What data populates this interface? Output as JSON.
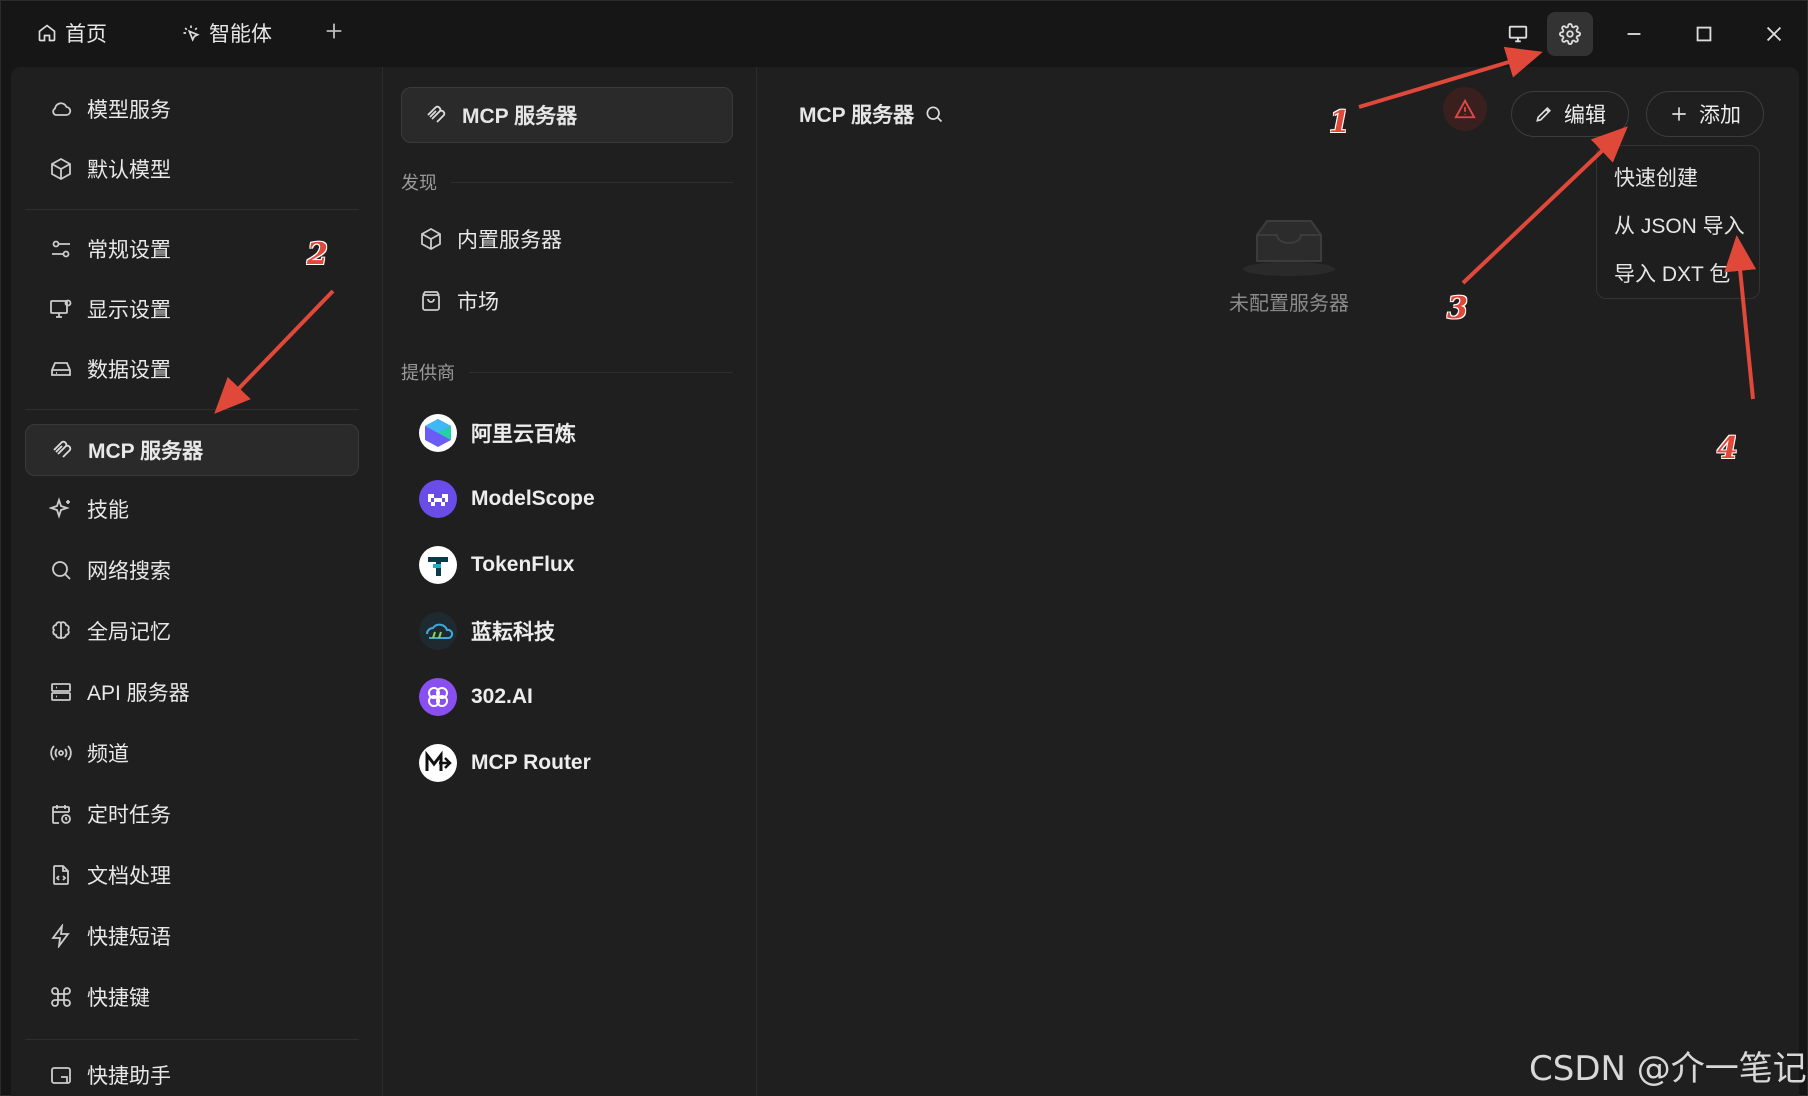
{
  "titlebar": {
    "tabs": [
      {
        "label": "首页",
        "icon": "home-icon"
      },
      {
        "label": "智能体",
        "icon": "sparkle-cursor-icon"
      }
    ]
  },
  "nav": {
    "items": [
      {
        "label": "模型服务",
        "icon": "cloud-icon"
      },
      {
        "label": "默认模型",
        "icon": "cube-icon"
      },
      {
        "label": "常规设置",
        "icon": "sliders-icon"
      },
      {
        "label": "显示设置",
        "icon": "monitor-gear-icon"
      },
      {
        "label": "数据设置",
        "icon": "hard-drive-icon"
      },
      {
        "label": "MCP 服务器",
        "icon": "mcp-icon",
        "active": true
      },
      {
        "label": "技能",
        "icon": "sparkles-icon"
      },
      {
        "label": "网络搜索",
        "icon": "search-icon"
      },
      {
        "label": "全局记忆",
        "icon": "brain-icon"
      },
      {
        "label": "API 服务器",
        "icon": "server-icon"
      },
      {
        "label": "频道",
        "icon": "broadcast-icon"
      },
      {
        "label": "定时任务",
        "icon": "calendar-clock-icon"
      },
      {
        "label": "文档处理",
        "icon": "file-code-icon"
      },
      {
        "label": "快捷短语",
        "icon": "zap-icon"
      },
      {
        "label": "快捷键",
        "icon": "command-icon"
      },
      {
        "label": "快捷助手",
        "icon": "assistant-icon"
      }
    ]
  },
  "mid": {
    "header": "MCP 服务器",
    "discover_label": "发现",
    "discover_items": [
      {
        "label": "内置服务器",
        "icon": "package-icon"
      },
      {
        "label": "市场",
        "icon": "shopping-bag-icon"
      }
    ],
    "providers_label": "提供商",
    "providers": [
      {
        "label": "阿里云百炼",
        "icon": "bailian-logo-icon"
      },
      {
        "label": "ModelScope",
        "icon": "modelscope-logo-icon"
      },
      {
        "label": "TokenFlux",
        "icon": "tokenflux-logo-icon"
      },
      {
        "label": "蓝耘科技",
        "icon": "lanyun-logo-icon"
      },
      {
        "label": "302.AI",
        "icon": "302ai-logo-icon"
      },
      {
        "label": "MCP Router",
        "icon": "mcp-router-logo-icon"
      }
    ]
  },
  "main": {
    "title": "MCP 服务器",
    "edit_label": "编辑",
    "add_label": "添加",
    "dropdown": [
      "快速创建",
      "从 JSON 导入",
      "导入 DXT 包"
    ],
    "empty_text": "未配置服务器"
  },
  "annotations": [
    "1",
    "2",
    "3",
    "4"
  ],
  "watermark": "CSDN @介一笔记",
  "colors": {
    "annotation": "#e0483a",
    "warning": "#e04848",
    "background": "#1f1f1f"
  }
}
